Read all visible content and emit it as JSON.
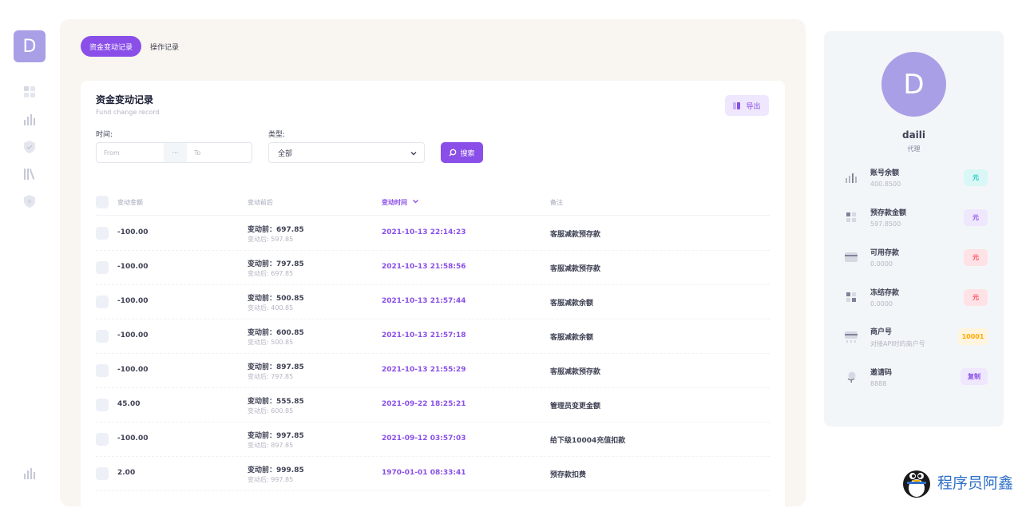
{
  "logo_letter": "D",
  "tabs": [
    {
      "label": "资金变动记录"
    },
    {
      "label": "操作记录"
    }
  ],
  "card": {
    "title": "资金变动记录",
    "subtitle": "Fund change record",
    "export_label": "导出"
  },
  "filters": {
    "time_label": "时间:",
    "from_placeholder": "From",
    "separator": "···",
    "to_placeholder": "To",
    "type_label": "类型:",
    "type_value": "全部",
    "search_label": "搜索"
  },
  "table": {
    "headers": [
      "变动金额",
      "变动前后",
      "变动时间",
      "备注"
    ],
    "rows": [
      {
        "amount": "-100.00",
        "before": "变动前：697.85",
        "after": "变动后: 597.85",
        "time": "2021-10-13 22:14:23",
        "note": "客服减款预存款"
      },
      {
        "amount": "-100.00",
        "before": "变动前：797.85",
        "after": "变动后: 697.85",
        "time": "2021-10-13 21:58:56",
        "note": "客服减款预存款"
      },
      {
        "amount": "-100.00",
        "before": "变动前：500.85",
        "after": "变动后: 400.85",
        "time": "2021-10-13 21:57:44",
        "note": "客服减款余额"
      },
      {
        "amount": "-100.00",
        "before": "变动前：600.85",
        "after": "变动后: 500.85",
        "time": "2021-10-13 21:57:18",
        "note": "客服减款余额"
      },
      {
        "amount": "-100.00",
        "before": "变动前：897.85",
        "after": "变动后: 797.85",
        "time": "2021-10-13 21:55:29",
        "note": "客服减款预存款"
      },
      {
        "amount": "45.00",
        "before": "变动前：555.85",
        "after": "变动后: 600.85",
        "time": "2021-09-22 18:25:21",
        "note": "管理员变更金额"
      },
      {
        "amount": "-100.00",
        "before": "变动前：997.85",
        "after": "变动后: 897.85",
        "time": "2021-09-12 03:57:03",
        "note": "给下级10004充值扣款"
      },
      {
        "amount": "2.00",
        "before": "变动前：999.85",
        "after": "变动后: 997.85",
        "time": "1970-01-01 08:33:41",
        "note": "预存款扣费"
      }
    ]
  },
  "profile": {
    "avatar_letter": "D",
    "name": "daili",
    "role": "代理",
    "stats": [
      {
        "label": "账号余额",
        "value": "400.8500",
        "badge": "元",
        "badge_bg": "#d9f7f6",
        "badge_color": "#1bc5bd",
        "icon": "bar-chart-icon"
      },
      {
        "label": "预存款金额",
        "value": "597.8500",
        "badge": "元",
        "badge_bg": "#efe7fd",
        "badge_color": "#8a4fe8",
        "icon": "grid-icon"
      },
      {
        "label": "可用存款",
        "value": "0.0000",
        "badge": "元",
        "badge_bg": "#ffe2e5",
        "badge_color": "#f64e60",
        "icon": "card-icon"
      },
      {
        "label": "冻结存款",
        "value": "0.0000",
        "badge": "元",
        "badge_bg": "#ffe2e5",
        "badge_color": "#f64e60",
        "icon": "grid-icon"
      },
      {
        "label": "商户号",
        "value": "对接API时的商户号",
        "badge": "10001",
        "badge_bg": "#fff4de",
        "badge_color": "#ffa800",
        "icon": "card-icon"
      },
      {
        "label": "邀请码",
        "value": "8888",
        "badge": "复制",
        "badge_bg": "#efe7fd",
        "badge_color": "#8a4fe8",
        "icon": "globe-icon"
      }
    ]
  },
  "watermark": {
    "text": "程序员阿鑫"
  }
}
